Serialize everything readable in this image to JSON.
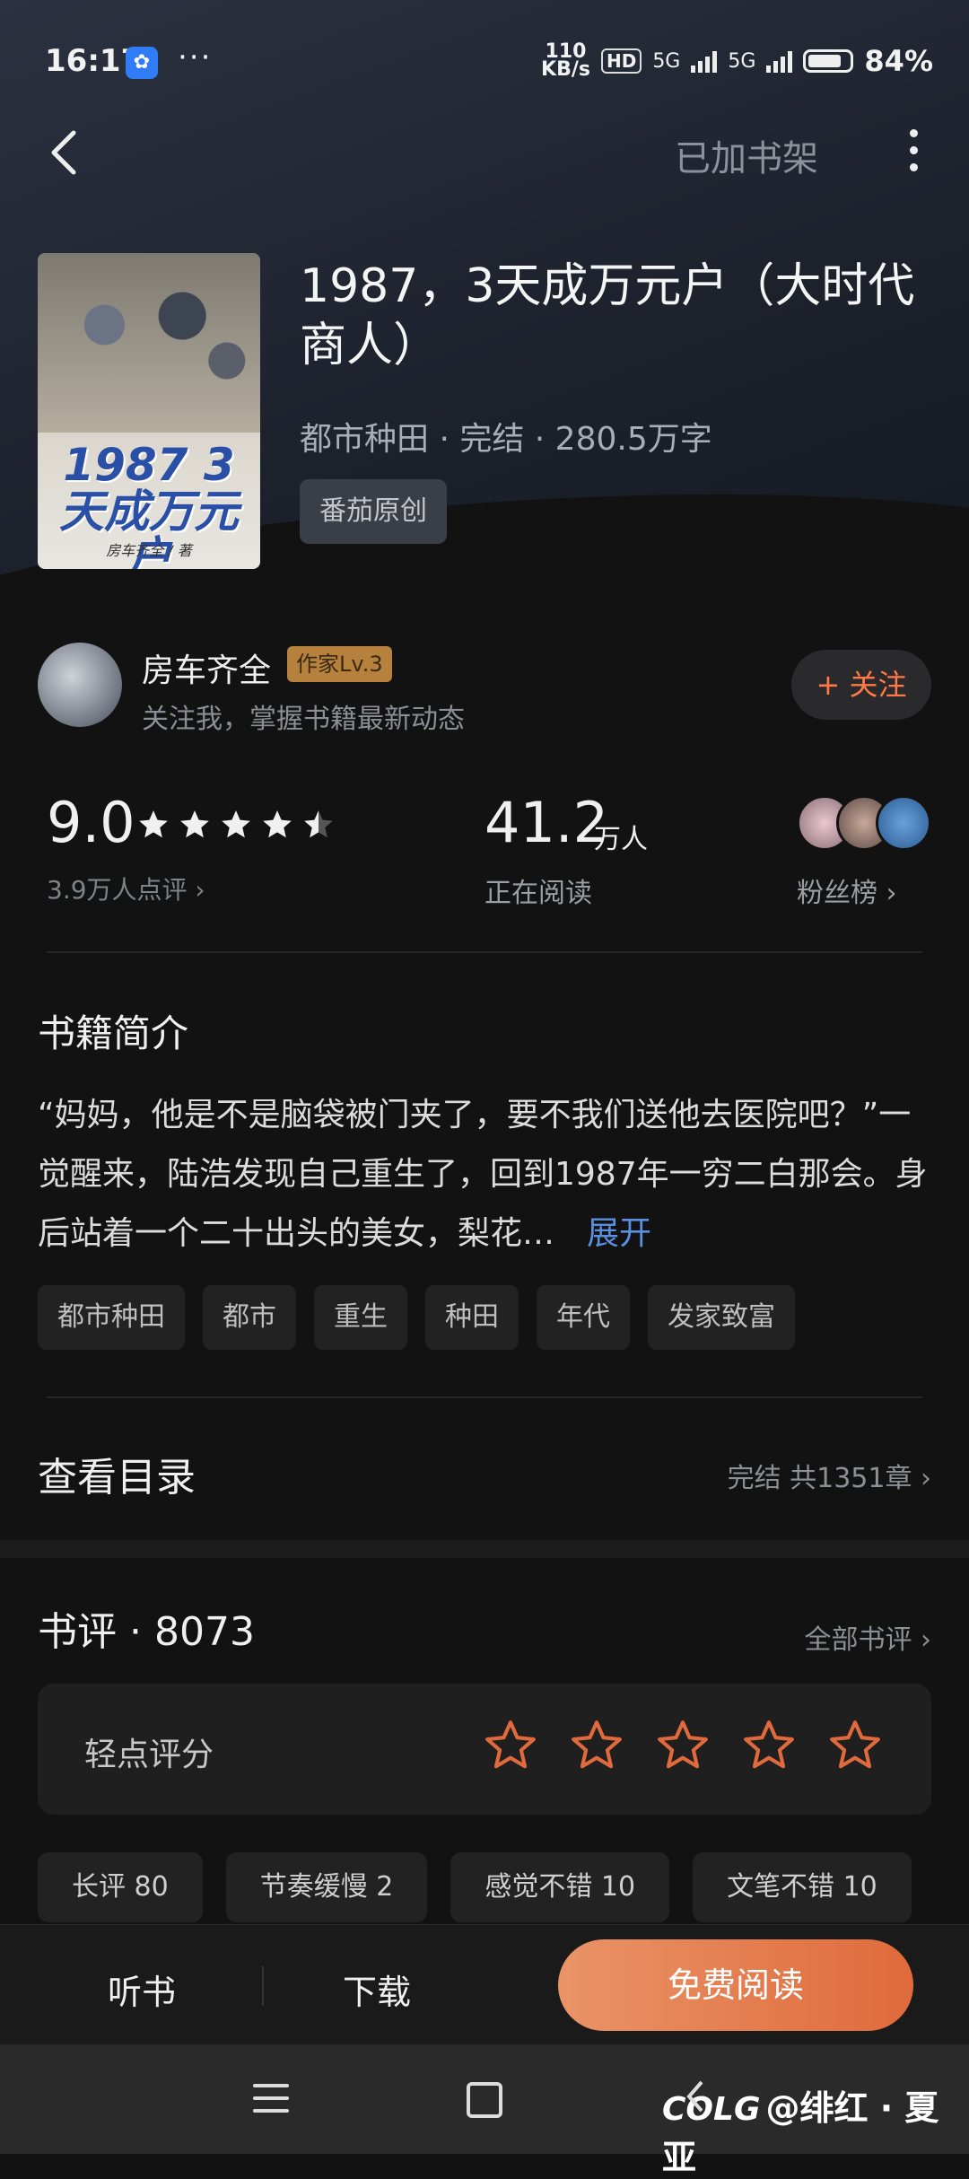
{
  "status_bar": {
    "time": "16:17",
    "speed_top": "110",
    "speed_bottom": "KB/s",
    "hd": "HD",
    "net1": "5G",
    "net2": "5G",
    "battery": "84%"
  },
  "topnav": {
    "shelf_status": "已加书架"
  },
  "book": {
    "cover_title": "1987 3天成万元户",
    "cover_author": "房车齐全 / 著",
    "title": "1987，3天成万元户（大时代商人）",
    "meta": "都市种田 · 完结 · 280.5万字",
    "tag": "番茄原创"
  },
  "author": {
    "name": "房车齐全",
    "badge": "作家Lv.3",
    "subtitle": "关注我，掌握书籍最新动态",
    "follow_label": "+ 关注"
  },
  "stats": {
    "score": "9.0",
    "rating_stars": 4.5,
    "score_sub": "3.9万人点评 ›",
    "reading": "41.2",
    "reading_unit": "万人",
    "reading_sub": "正在阅读",
    "fans_label": "粉丝榜 ›"
  },
  "synopsis": {
    "heading": "书籍简介",
    "text": "“妈妈，他是不是脑袋被门夹了，要不我们送他去医院吧？”一觉醒来，陆浩发现自己重生了，回到1987年一穷二白那会。身后站着一个二十出头的美女，梨花…",
    "expand": "展开",
    "genres": [
      "都市种田",
      "都市",
      "重生",
      "种田",
      "年代",
      "发家致富"
    ]
  },
  "toc": {
    "title": "查看目录",
    "right": "完结 共1351章 ›"
  },
  "reviews": {
    "heading": "书评 · 8073",
    "all_label": "全部书评 ›",
    "rate_label": "轻点评分",
    "chips": [
      "长评 80",
      "节奏缓慢 2",
      "感觉不错 10",
      "文笔不错 10"
    ]
  },
  "bottom_bar": {
    "listen": "听书",
    "download": "下载",
    "read": "免费阅读"
  },
  "watermark": {
    "logo": "COLG",
    "text": "@绯红 · 夏亚"
  },
  "colors": {
    "accent": "#e06a3b",
    "link": "#5b8fe0",
    "badge": "#b5813d"
  }
}
